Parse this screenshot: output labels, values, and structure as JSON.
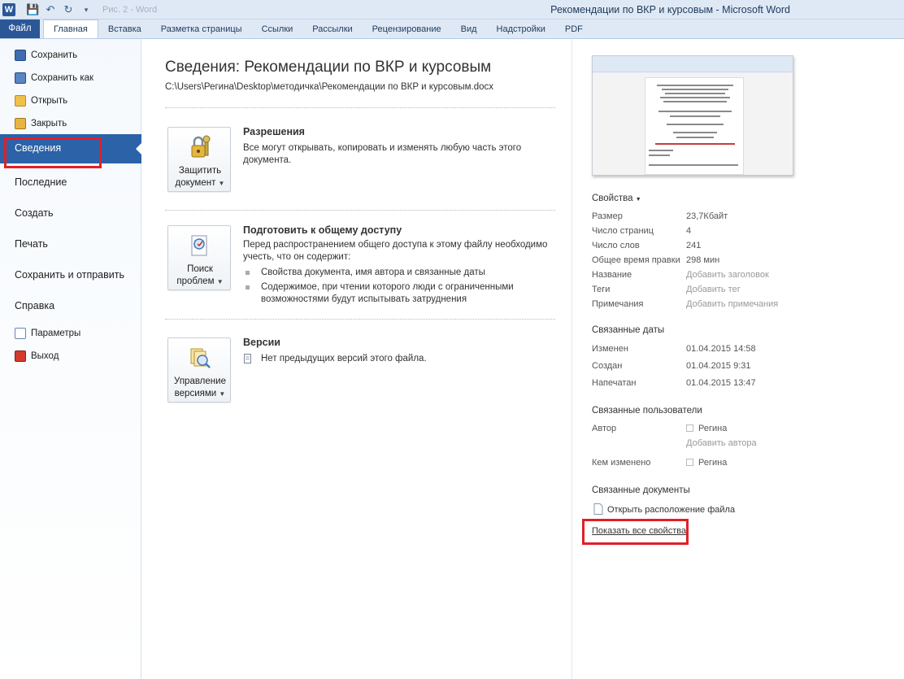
{
  "window": {
    "title": "Рекомендации по ВКР и курсовым  -  Microsoft Word",
    "qat_hint": "Рис. 2 - Word"
  },
  "ribbon": {
    "file_tab": "Файл",
    "tabs": [
      "Главная",
      "Вставка",
      "Разметка страницы",
      "Ссылки",
      "Рассылки",
      "Рецензирование",
      "Вид",
      "Надстройки",
      "PDF"
    ]
  },
  "nav": {
    "save": "Сохранить",
    "save_as": "Сохранить как",
    "open": "Открыть",
    "close": "Закрыть",
    "info": "Сведения",
    "recent": "Последние",
    "new": "Создать",
    "print": "Печать",
    "save_send": "Сохранить и отправить",
    "help": "Справка",
    "options": "Параметры",
    "exit": "Выход"
  },
  "info": {
    "title": "Сведения: Рекомендации по ВКР и курсовым",
    "path": "C:\\Users\\Регина\\Desktop\\методичка\\Рекомендации по ВКР и курсовым.docx",
    "permissions": {
      "button_line1": "Защитить",
      "button_line2": "документ",
      "title": "Разрешения",
      "text": "Все могут открывать, копировать и изменять любую часть этого документа."
    },
    "prepare": {
      "button_line1": "Поиск",
      "button_line2": "проблем",
      "title": "Подготовить к общему доступу",
      "text": "Перед распространением общего доступа к этому файлу необходимо учесть, что он содержит:",
      "bullet1": "Свойства документа, имя автора и связанные даты",
      "bullet2": "Содержимое, при чтении которого люди с ограниченными возможностями будут испытывать затруднения"
    },
    "versions": {
      "button_line1": "Управление",
      "button_line2": "версиями",
      "title": "Версии",
      "text": "Нет предыдущих версий этого файла."
    }
  },
  "properties": {
    "header": "Свойства",
    "size_label": "Размер",
    "size_value": "23,7Кбайт",
    "pages_label": "Число страниц",
    "pages_value": "4",
    "words_label": "Число слов",
    "words_value": "241",
    "edit_time_label": "Общее время правки",
    "edit_time_value": "298 мин",
    "title_label": "Название",
    "title_value": "Добавить заголовок",
    "tags_label": "Теги",
    "tags_value": "Добавить тег",
    "comments_label": "Примечания",
    "comments_value": "Добавить примечания",
    "dates_header": "Связанные даты",
    "modified_label": "Изменен",
    "modified_value": "01.04.2015 14:58",
    "created_label": "Создан",
    "created_value": "01.04.2015 9:31",
    "printed_label": "Напечатан",
    "printed_value": "01.04.2015 13:47",
    "people_header": "Связанные пользователи",
    "author_label": "Автор",
    "author_value": "Регина",
    "add_author": "Добавить автора",
    "modified_by_label": "Кем изменено",
    "modified_by_value": "Регина",
    "docs_header": "Связанные документы",
    "open_location": "Открыть расположение файла",
    "show_all": "Показать все свойства"
  },
  "colors": {
    "accent": "#2b62a8",
    "file_tab": "#2b5797",
    "highlight": "#e02028"
  }
}
